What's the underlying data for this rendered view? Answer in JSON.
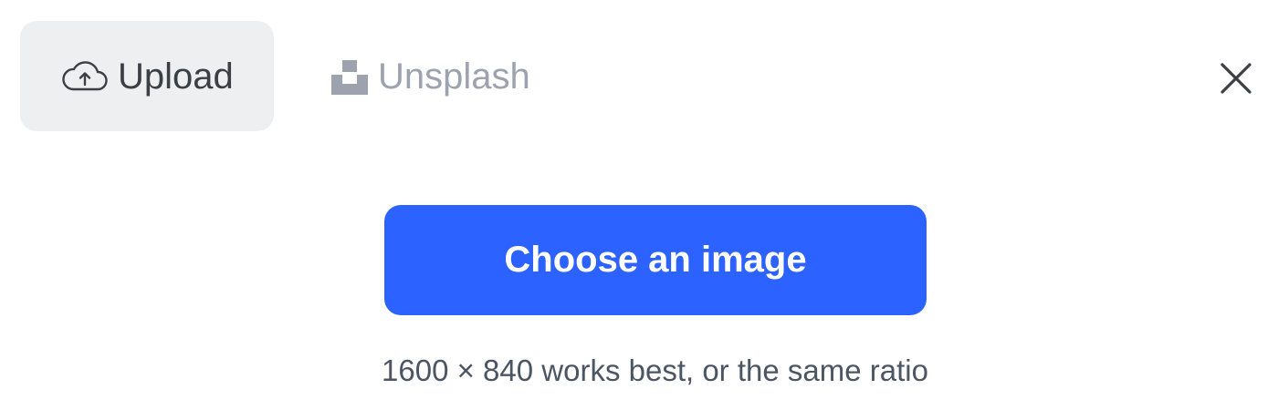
{
  "tabs": [
    {
      "label": "Upload",
      "icon": "cloud-upload-icon",
      "active": true
    },
    {
      "label": "Unsplash",
      "icon": "unsplash-icon",
      "active": false
    }
  ],
  "dialog": {
    "close_icon": "close-icon"
  },
  "main": {
    "choose_button_label": "Choose an image",
    "hint": "1600 × 840 works best, or the same ratio"
  },
  "colors": {
    "accent": "#2c62ff",
    "active_tab_bg": "#eeeff1",
    "inactive_text": "#9ca3af",
    "text": "#3b3f46"
  }
}
